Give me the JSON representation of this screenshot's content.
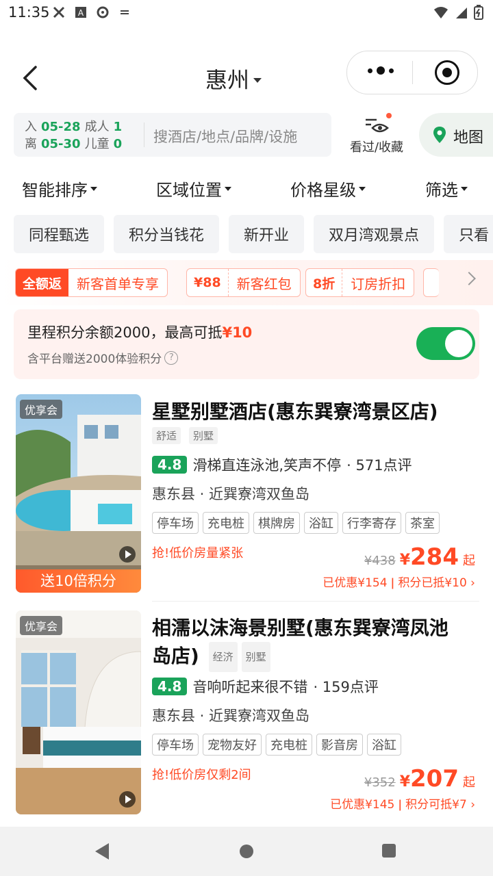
{
  "status": {
    "time": "11:35"
  },
  "header": {
    "city": "惠州"
  },
  "search": {
    "checkin_label": "入",
    "checkin_date": "05-28",
    "checkout_label": "离",
    "checkout_date": "05-30",
    "adults_label": "成人",
    "adults": "1",
    "children_label": "儿童",
    "children": "0",
    "placeholder": "搜酒店/地点/品牌/设施",
    "favorites_label": "看过/收藏",
    "map_label": "地图"
  },
  "sort": {
    "items": [
      "智能排序",
      "区域位置",
      "价格星级",
      "筛选"
    ]
  },
  "chips": [
    "同程甄选",
    "积分当钱花",
    "新开业",
    "双月湾观景点",
    "只看"
  ],
  "promo": [
    {
      "tag": "全额返",
      "text": "新客首单专享"
    },
    {
      "tag": "¥88",
      "text": "新客红包"
    },
    {
      "tag": "8折",
      "text": "订房折扣"
    }
  ],
  "points": {
    "line1_prefix": "里程积分余额2000，最高可抵",
    "line1_amount": "¥10",
    "line2": "含平台赠送2000体验积分",
    "toggle_on": true
  },
  "hotels": [
    {
      "badge": "优享会",
      "bonus": "送10倍积分",
      "name": "星墅别墅酒店(惠东巽寮湾景区店)",
      "tags": [
        "舒适",
        "别墅"
      ],
      "score": "4.8",
      "review_quote": "滑梯直连泳池,笑声不停",
      "reviews": "· 571点评",
      "location": "惠东县 · 近巽寮湾双鱼岛",
      "facilities": [
        "停车场",
        "充电桩",
        "棋牌房",
        "浴缸",
        "行李寄存",
        "茶室"
      ],
      "urgent": "抢!低价房量紧张",
      "original_price": "¥438",
      "price_symbol": "¥",
      "price": "284",
      "price_suffix": "起",
      "discount": "已优惠¥154 ǀ 积分已抵¥10 ›"
    },
    {
      "badge": "优享会",
      "name_line1": "相濡以沫海景别墅(惠东巽寮湾凤池",
      "name_line2": "岛店)",
      "tags": [
        "经济",
        "别墅"
      ],
      "score": "4.8",
      "review_quote": "音响听起来很不错",
      "reviews": "· 159点评",
      "location": "惠东县 · 近巽寮湾双鱼岛",
      "facilities": [
        "停车场",
        "宠物友好",
        "充电桩",
        "影音房",
        "浴缸"
      ],
      "urgent": "抢!低价房仅剩2间",
      "original_price": "¥352",
      "price_symbol": "¥",
      "price": "207",
      "price_suffix": "起",
      "discount": "已优惠¥145 ǀ 积分可抵¥7 ›"
    }
  ]
}
